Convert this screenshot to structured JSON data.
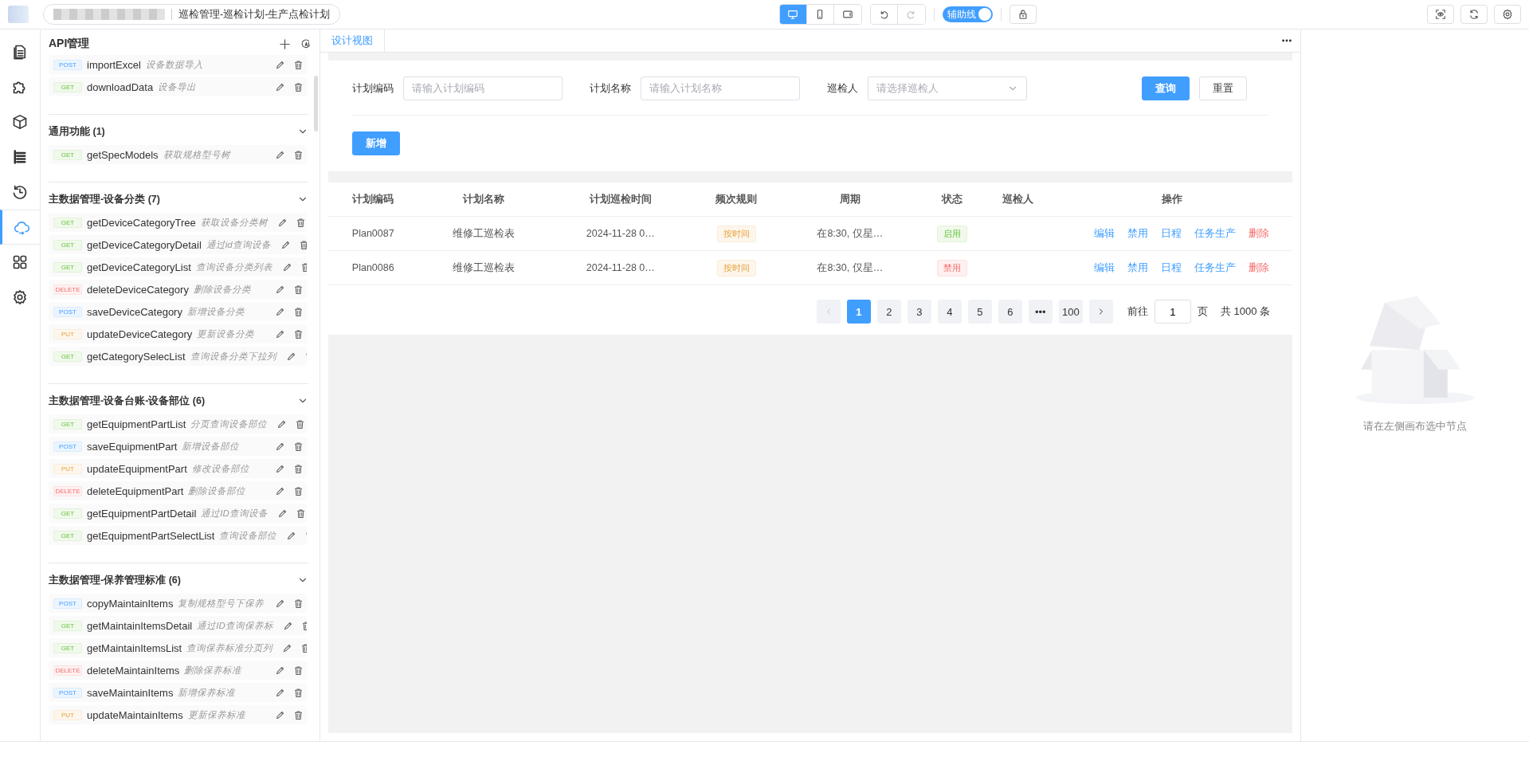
{
  "topbar": {
    "breadcrumb": "巡检管理-巡检计划-生产点检计划",
    "device_modes": [
      {
        "selected": true
      },
      {
        "selected": false
      },
      {
        "selected": false
      }
    ],
    "guide_toggle": {
      "label": "辅助线",
      "on": true
    }
  },
  "rail": [
    {
      "selected": false
    },
    {
      "selected": false
    },
    {
      "selected": false
    },
    {
      "selected": false
    },
    {
      "selected": false
    },
    {
      "selected": true
    },
    {
      "selected": false
    },
    {
      "selected": false
    }
  ],
  "sidebar": {
    "title": "API管理",
    "groups": [
      {
        "items": [
          {
            "kind": "post",
            "method": "POST",
            "name": "importExcel",
            "desc": "设备数据导入"
          },
          {
            "kind": "get",
            "method": "GET",
            "name": "downloadData",
            "desc": "设备导出"
          }
        ]
      },
      {
        "title": "通用功能 (1)",
        "items": [
          {
            "kind": "get",
            "method": "GET",
            "name": "getSpecModels",
            "desc": "获取规格型号树"
          }
        ]
      },
      {
        "title": "主数据管理-设备分类 (7)",
        "items": [
          {
            "kind": "get",
            "method": "GET",
            "name": "getDeviceCategoryTree",
            "desc": "获取设备分类树"
          },
          {
            "kind": "get",
            "method": "GET",
            "name": "getDeviceCategoryDetail",
            "desc": "通过id查询设备"
          },
          {
            "kind": "get",
            "method": "GET",
            "name": "getDeviceCategoryList",
            "desc": "查询设备分类列表"
          },
          {
            "kind": "delete",
            "method": "DELETE",
            "name": "deleteDeviceCategory",
            "desc": "删除设备分类"
          },
          {
            "kind": "post",
            "method": "POST",
            "name": "saveDeviceCategory",
            "desc": "新增设备分类"
          },
          {
            "kind": "put",
            "method": "PUT",
            "name": "updateDeviceCategory",
            "desc": "更新设备分类"
          },
          {
            "kind": "get",
            "method": "GET",
            "name": "getCategorySelecList",
            "desc": "查询设备分类下拉列"
          }
        ]
      },
      {
        "title": "主数据管理-设备台账-设备部位 (6)",
        "items": [
          {
            "kind": "get",
            "method": "GET",
            "name": "getEquipmentPartList",
            "desc": "分页查询设备部位"
          },
          {
            "kind": "post",
            "method": "POST",
            "name": "saveEquipmentPart",
            "desc": "新增设备部位"
          },
          {
            "kind": "put",
            "method": "PUT",
            "name": "updateEquipmentPart",
            "desc": "修改设备部位"
          },
          {
            "kind": "delete",
            "method": "DELETE",
            "name": "deleteEquipmentPart",
            "desc": "删除设备部位"
          },
          {
            "kind": "get",
            "method": "GET",
            "name": "getEquipmentPartDetail",
            "desc": "通过ID查询设备"
          },
          {
            "kind": "get",
            "method": "GET",
            "name": "getEquipmentPartSelectList",
            "desc": "查询设备部位"
          }
        ]
      },
      {
        "title": "主数据管理-保养管理标准 (6)",
        "items": [
          {
            "kind": "post",
            "method": "POST",
            "name": "copyMaintainItems",
            "desc": "复制规格型号下保养"
          },
          {
            "kind": "get",
            "method": "GET",
            "name": "getMaintainItemsDetail",
            "desc": "通过ID查询保养标"
          },
          {
            "kind": "get",
            "method": "GET",
            "name": "getMaintainItemsList",
            "desc": "查询保养标准分页列"
          },
          {
            "kind": "delete",
            "method": "DELETE",
            "name": "deleteMaintainItems",
            "desc": "删除保养标准"
          },
          {
            "kind": "post",
            "method": "POST",
            "name": "saveMaintainItems",
            "desc": "新增保养标准"
          },
          {
            "kind": "put",
            "method": "PUT",
            "name": "updateMaintainItems",
            "desc": "更新保养标准"
          }
        ]
      }
    ]
  },
  "designer": {
    "tabs": [
      {
        "label": "设计视图",
        "selected": true
      }
    ],
    "filters": [
      {
        "kind": "input",
        "label": "计划编码",
        "placeholder": "请输入计划编码"
      },
      {
        "kind": "input",
        "label": "计划名称",
        "placeholder": "请输入计划名称"
      },
      {
        "kind": "select",
        "label": "巡检人",
        "placeholder": "请选择巡检人"
      }
    ],
    "query_button": "查询",
    "reset_button": "重置",
    "add_button": "新增",
    "table": {
      "columns": [
        "计划编码",
        "计划名称",
        "计划巡检时间",
        "频次规则",
        "周期",
        "状态",
        "巡检人",
        "操作"
      ],
      "rows": [
        {
          "code": "Plan0087",
          "name": "维修工巡检表",
          "time": "2024-11-28 0…",
          "rule": "按时间",
          "cycle": "在8:30, 仅星…",
          "status": {
            "label": "启用",
            "kind": "on"
          },
          "actions": [
            {
              "label": "编辑",
              "kind": "normal"
            },
            {
              "label": "禁用",
              "kind": "normal"
            },
            {
              "label": "日程",
              "kind": "normal"
            },
            {
              "label": "任务生产",
              "kind": "normal"
            },
            {
              "label": "删除",
              "kind": "danger"
            }
          ]
        },
        {
          "code": "Plan0086",
          "name": "维修工巡检表",
          "time": "2024-11-28 0…",
          "rule": "按时间",
          "cycle": "在8:30, 仅星…",
          "status": {
            "label": "禁用",
            "kind": "off"
          },
          "actions": [
            {
              "label": "编辑",
              "kind": "normal"
            },
            {
              "label": "禁用",
              "kind": "normal"
            },
            {
              "label": "日程",
              "kind": "normal"
            },
            {
              "label": "任务生产",
              "kind": "normal"
            },
            {
              "label": "删除",
              "kind": "danger"
            }
          ]
        }
      ]
    },
    "pagination": {
      "prev_disabled": true,
      "pages": [
        {
          "label": "1",
          "selected": true
        },
        {
          "label": "2",
          "selected": false
        },
        {
          "label": "3",
          "selected": false
        },
        {
          "label": "4",
          "selected": false
        },
        {
          "label": "5",
          "selected": false
        },
        {
          "label": "6",
          "selected": false
        },
        {
          "label": "•••",
          "selected": false
        },
        {
          "label": "100",
          "selected": false
        }
      ],
      "goto_label": "前往",
      "goto_value": "1",
      "page_unit": "页",
      "total": "共 1000 条"
    }
  },
  "inspector": {
    "empty_text": "请在左侧画布选中节点"
  }
}
